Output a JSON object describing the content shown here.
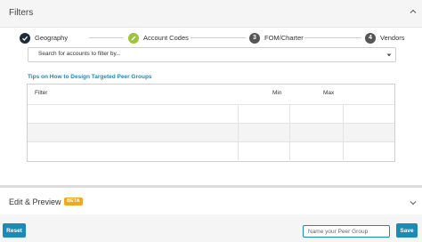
{
  "filters": {
    "title": "Filters",
    "steps": [
      {
        "marker": "",
        "label": "Geography",
        "state": "complete"
      },
      {
        "marker": "",
        "label": "Account Codes",
        "state": "editing"
      },
      {
        "marker": "3",
        "label": "FOM/Charter",
        "state": "pending"
      },
      {
        "marker": "4",
        "label": "Vendors",
        "state": "pending"
      }
    ],
    "search_placeholder": "Search for accounts to filter by...",
    "tips_link": "Tips on How to Design Targeted Peer Groups",
    "table": {
      "headers": {
        "filter": "Filter",
        "min": "Min",
        "max": "Max"
      }
    }
  },
  "edit_preview": {
    "title": "Edit & Preview",
    "badge": "BETA"
  },
  "footer": {
    "reset_label": "Reset",
    "peer_group_placeholder": "Name your Peer Group",
    "save_label": "Save"
  },
  "colors": {
    "accent": "#1b8ab5",
    "step_complete": "#1f2b3a",
    "step_editing": "#9cc33a",
    "step_pending": "#555555",
    "badge": "#f0a722"
  }
}
